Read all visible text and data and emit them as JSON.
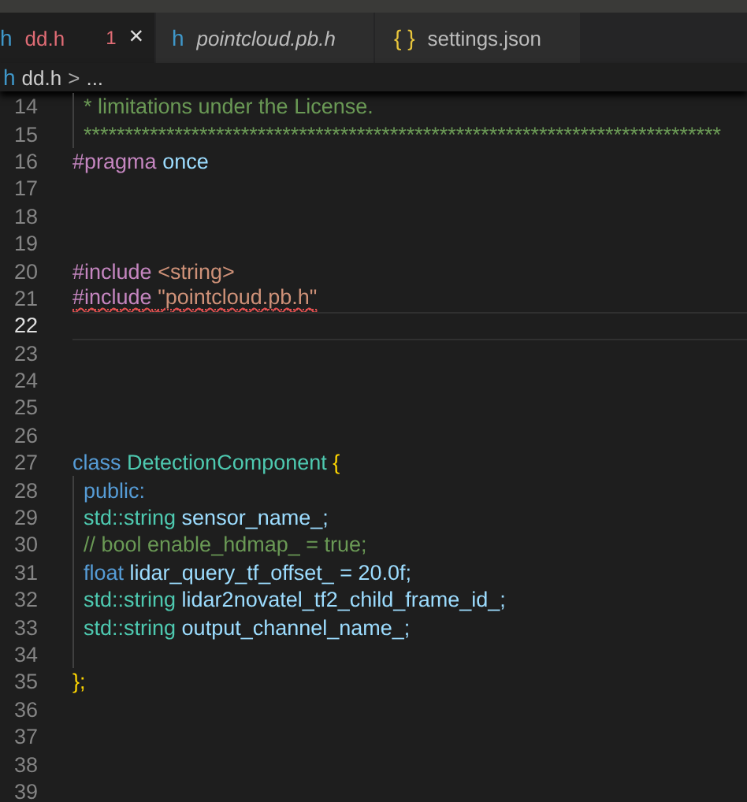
{
  "tabs": [
    {
      "icon": "h",
      "kind": "header",
      "label": "dd.h",
      "problems": "1",
      "close": "×",
      "selected": true,
      "preview": false
    },
    {
      "icon": "h",
      "kind": "header",
      "label": "pointcloud.pb.h",
      "selected": false,
      "preview": true
    },
    {
      "icon": "{ }",
      "kind": "json",
      "label": "settings.json",
      "selected": false,
      "preview": false
    }
  ],
  "breadcrumb": {
    "icon": "h",
    "file": "dd.h",
    "separator": ">",
    "rest": "..."
  },
  "lines": [
    {
      "number": "14",
      "current": false,
      "error": false,
      "guide": true,
      "tokens": [
        {
          "kind": "comment",
          "text": "* limitations under the License."
        }
      ]
    },
    {
      "number": "15",
      "current": false,
      "error": false,
      "guide": true,
      "tokens": [
        {
          "kind": "comment",
          "text": "*****************************************************************************"
        }
      ]
    },
    {
      "number": "16",
      "current": false,
      "error": false,
      "guide": false,
      "tokens": [
        {
          "kind": "directive",
          "text": "#pragma"
        },
        {
          "kind": "variable",
          "text": "once"
        }
      ]
    },
    {
      "number": "17",
      "current": false,
      "guide": false
    },
    {
      "number": "18",
      "current": false,
      "guide": false
    },
    {
      "number": "19",
      "current": false,
      "guide": false
    },
    {
      "number": "20",
      "current": false,
      "error": false,
      "guide": false,
      "tokens": [
        {
          "kind": "directive",
          "text": "#include"
        },
        {
          "kind": "string",
          "text": "<string>"
        }
      ]
    },
    {
      "number": "21",
      "current": false,
      "error": true,
      "guide": false,
      "tokens": [
        {
          "kind": "directive",
          "text": "#include"
        },
        {
          "kind": "string",
          "text": "\"pointcloud.pb.h\""
        }
      ]
    },
    {
      "number": "22",
      "current": true,
      "guide": false
    },
    {
      "number": "23",
      "current": false,
      "guide": false
    },
    {
      "number": "24",
      "current": false,
      "guide": false
    },
    {
      "number": "25",
      "current": false,
      "guide": false
    },
    {
      "number": "26",
      "current": false,
      "guide": false
    },
    {
      "number": "27",
      "current": false,
      "error": false,
      "guide": false,
      "tokens": [
        {
          "kind": "keyword",
          "text": "class"
        },
        {
          "kind": "type",
          "text": "DetectionComponent"
        },
        {
          "kind": "brace",
          "text": "{"
        }
      ]
    },
    {
      "number": "28",
      "current": false,
      "error": false,
      "guide": true,
      "tokens": [
        {
          "kind": "keyword",
          "text": "public:"
        }
      ]
    },
    {
      "number": "29",
      "current": false,
      "error": false,
      "guide": true,
      "tokens": [
        {
          "kind": "type",
          "text": "std::string"
        },
        {
          "kind": "variable",
          "text": "sensor_name_;"
        }
      ]
    },
    {
      "number": "30",
      "current": false,
      "error": false,
      "guide": true,
      "tokens": [
        {
          "kind": "comment",
          "text": "// bool enable_hdmap_ = true;"
        }
      ]
    },
    {
      "number": "31",
      "current": false,
      "error": false,
      "guide": true,
      "tokens": [
        {
          "kind": "keyword",
          "text": "float"
        },
        {
          "kind": "variable",
          "text": "lidar_query_tf_offset_ = 20.0f;"
        }
      ]
    },
    {
      "number": "32",
      "current": false,
      "error": false,
      "guide": true,
      "tokens": [
        {
          "kind": "type",
          "text": "std::string"
        },
        {
          "kind": "variable",
          "text": "lidar2novatel_tf2_child_frame_id_;"
        }
      ]
    },
    {
      "number": "33",
      "current": false,
      "error": false,
      "guide": true,
      "tokens": [
        {
          "kind": "type",
          "text": "std::string"
        },
        {
          "kind": "variable",
          "text": "output_channel_name_;"
        }
      ]
    },
    {
      "number": "34",
      "current": false,
      "guide": true
    },
    {
      "number": "35",
      "current": false,
      "error": false,
      "guide": false,
      "tokens": [
        {
          "kind": "brace",
          "text": "};"
        }
      ]
    },
    {
      "number": "36",
      "current": false,
      "guide": false
    },
    {
      "number": "37",
      "current": false,
      "guide": false
    },
    {
      "number": "38",
      "current": false,
      "guide": false
    },
    {
      "number": "39",
      "current": false,
      "guide": false
    }
  ]
}
